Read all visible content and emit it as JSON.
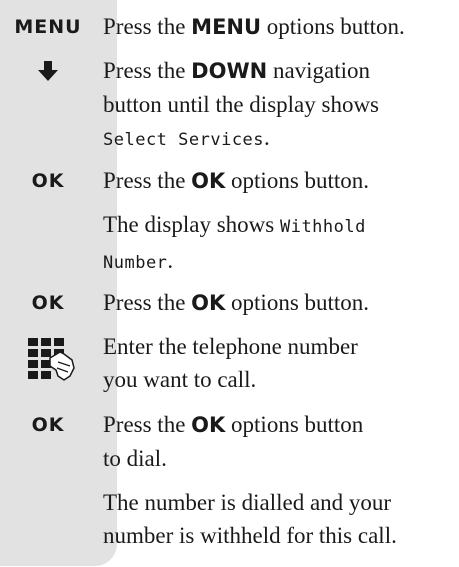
{
  "steps": [
    {
      "icon": "MENU",
      "parts": {
        "pre": "Press the ",
        "bold": "MENU",
        "post": " options button."
      }
    },
    {
      "icon": "down-arrow-icon",
      "parts": {
        "pre": "Press the ",
        "bold": "DOWN",
        "post": " navigation",
        "line2": "button until the display shows",
        "lcd": "Select Services",
        "end": "."
      }
    },
    {
      "icon": "OK",
      "parts": {
        "pre": "Press the ",
        "bold": "OK",
        "post": " options button."
      }
    },
    {
      "icon": "",
      "parts": {
        "pre": "The display shows ",
        "lcd1": "Withhold",
        "lcd2": "Number",
        "end": "."
      }
    },
    {
      "icon": "OK",
      "parts": {
        "pre": "Press the ",
        "bold": "OK",
        "post": " options button."
      }
    },
    {
      "icon": "keypad-icon",
      "parts": {
        "line1": "Enter the telephone number",
        "line2": "you want to call."
      }
    },
    {
      "icon": "OK",
      "parts": {
        "pre": "Press the ",
        "bold": "OK",
        "post": " options button",
        "line2": "to dial."
      }
    },
    {
      "icon": "",
      "parts": {
        "line1": "The number is dialled and your",
        "line2": "number is withheld for this call."
      }
    }
  ]
}
